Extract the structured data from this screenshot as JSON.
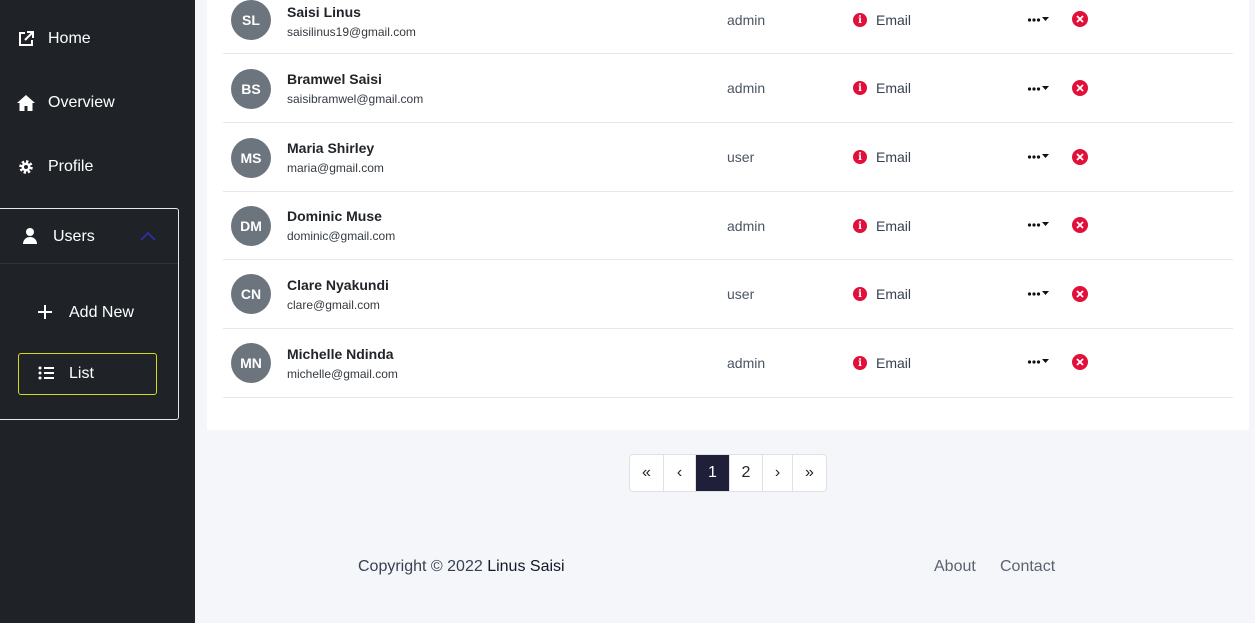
{
  "sidebar": {
    "items": [
      {
        "label": "Home",
        "icon": "external-link-icon"
      },
      {
        "label": "Overview",
        "icon": "home-icon"
      },
      {
        "label": "Profile",
        "icon": "gear-icon"
      }
    ],
    "users": {
      "label": "Users",
      "icon": "user-icon",
      "sub": [
        {
          "label": "Add New",
          "icon": "plus-icon"
        },
        {
          "label": "List",
          "icon": "list-icon"
        }
      ]
    }
  },
  "users": [
    {
      "initials": "SL",
      "name": "Saisi Linus",
      "email": "saisilinus19@gmail.com",
      "role": "admin",
      "status": "Email"
    },
    {
      "initials": "BS",
      "name": "Bramwel Saisi",
      "email": "saisibramwel@gmail.com",
      "role": "admin",
      "status": "Email"
    },
    {
      "initials": "MS",
      "name": "Maria Shirley",
      "email": "maria@gmail.com",
      "role": "user",
      "status": "Email"
    },
    {
      "initials": "DM",
      "name": "Dominic Muse",
      "email": "dominic@gmail.com",
      "role": "admin",
      "status": "Email"
    },
    {
      "initials": "CN",
      "name": "Clare Nyakundi",
      "email": "clare@gmail.com",
      "role": "user",
      "status": "Email"
    },
    {
      "initials": "MN",
      "name": "Michelle Ndinda",
      "email": "michelle@gmail.com",
      "role": "admin",
      "status": "Email"
    }
  ],
  "pagination": {
    "first": "«",
    "prev": "‹",
    "pages": [
      "1",
      "2"
    ],
    "current": "1",
    "next": "›",
    "last": "»"
  },
  "footer": {
    "copyright_prefix": "Copyright © 2022",
    "owner": "Linus Saisi",
    "links": [
      "About",
      "Contact"
    ]
  },
  "colors": {
    "sidebar_bg": "#1f2327",
    "page_bg": "#f4f6fa",
    "danger": "#e0103a",
    "active_page": "#1f1f3a",
    "list_border": "#d4d91a",
    "avatar_bg": "#6c757d"
  }
}
